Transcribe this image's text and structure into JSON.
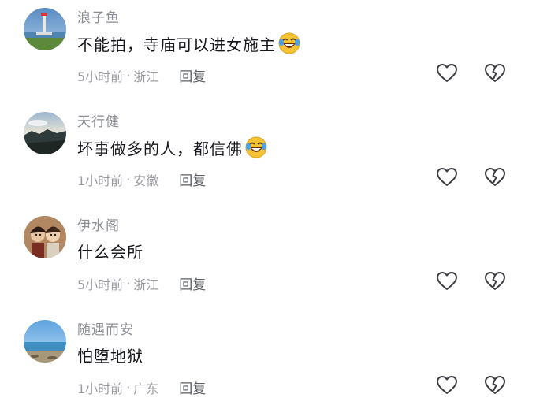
{
  "comments": [
    {
      "username": "浪子鱼",
      "text": "不能拍，寺庙可以进女施主",
      "emoji": "laughing-crying-emoji",
      "time": "5小时前",
      "separator": "·",
      "location": "浙江",
      "reply_label": "回复"
    },
    {
      "username": "天行健",
      "text": "坏事做多的人，都信佛",
      "emoji": "laughing-crying-emoji",
      "time": "1小时前",
      "separator": "·",
      "location": "安徽",
      "reply_label": "回复"
    },
    {
      "username": "伊水阁",
      "text": "什么会所",
      "time": "5小时前",
      "separator": "·",
      "location": "浙江",
      "reply_label": "回复"
    },
    {
      "username": "随遇而安",
      "text": "怕堕地狱",
      "time": "1小时前",
      "separator": "·",
      "location": "广东",
      "reply_label": "回复"
    }
  ],
  "icons": {
    "like": "heart-outline-icon",
    "dislike": "broken-heart-outline-icon"
  },
  "colors": {
    "username": "#8a8d93",
    "content": "#16181d",
    "meta": "#9a9ca2",
    "reply": "#5b5e64",
    "icon": "#3a3c40"
  }
}
